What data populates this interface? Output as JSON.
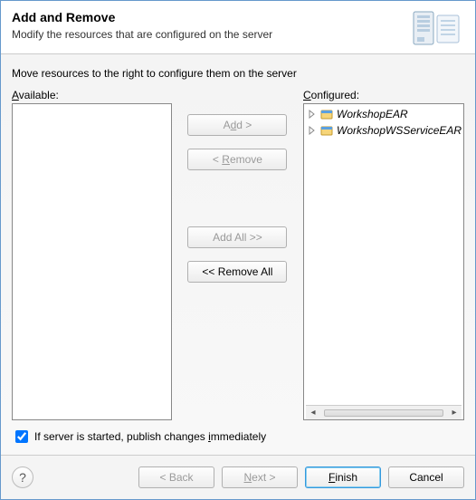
{
  "header": {
    "title": "Add and Remove",
    "subtitle": "Modify the resources that are configured on the server"
  },
  "body": {
    "instructions": "Move resources to the right to configure them on the server",
    "available": {
      "label_pre": "A",
      "label_rest": "vailable:",
      "items": []
    },
    "configured": {
      "label_pre": "C",
      "label_rest": "onfigured:",
      "items": [
        {
          "label": "WorkshopEAR"
        },
        {
          "label": "WorkshopWSServiceEAR"
        }
      ]
    },
    "buttons": {
      "add_pre": "A",
      "add_mid": "d",
      "add_post": "d >",
      "remove_pre": "< ",
      "remove_u": "R",
      "remove_post": "emove",
      "add_all": "Add All >>",
      "remove_all": "<< Remove All"
    },
    "checkbox": {
      "checked": true,
      "label_pre": "If server is started, publish changes ",
      "label_u": "i",
      "label_post": "mmediately"
    }
  },
  "footer": {
    "back": "< Back",
    "next_pre": "",
    "next_u": "N",
    "next_post": "ext >",
    "finish_pre": "",
    "finish_u": "F",
    "finish_post": "inish",
    "cancel": "Cancel"
  }
}
